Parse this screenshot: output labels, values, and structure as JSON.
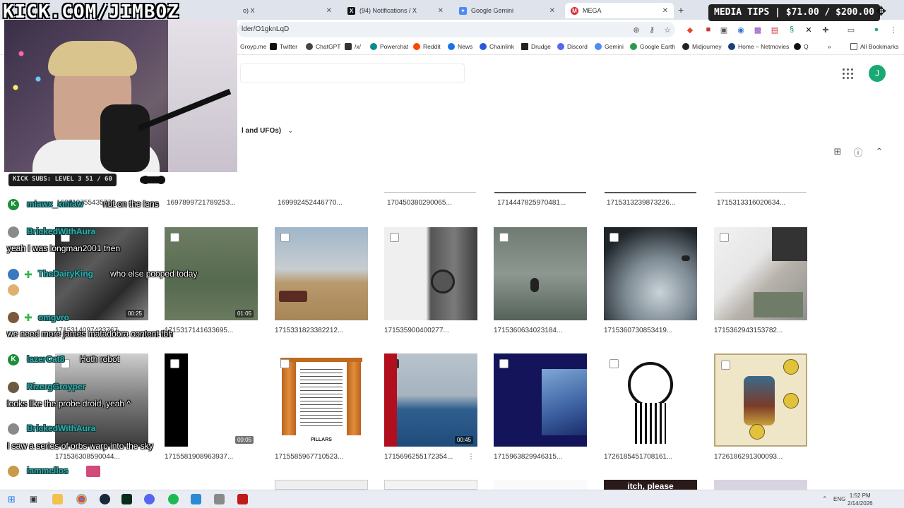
{
  "overlay": {
    "watermark": "KICK.COM/JIMBOZ",
    "media_tips": "MEDIA TIPS | $71.00 / $200.00",
    "kick_subs": "KICK SUBS: LEVEL 3 51 / 60"
  },
  "tabs": [
    {
      "label": "o) X",
      "favicon": "x-icon"
    },
    {
      "label": "(94) Notifications / X",
      "favicon": "x-icon"
    },
    {
      "label": "Google Gemini",
      "favicon": "gemini-icon"
    },
    {
      "label": "MEGA",
      "favicon": "mega-icon",
      "active": true
    }
  ],
  "address": {
    "url": "lder/O1gknLqD"
  },
  "bookmarks": [
    {
      "label": "Groyp.me",
      "color": "#8b6bd6"
    },
    {
      "label": "Twitter",
      "color": "#111111"
    },
    {
      "label": "ChatGPT",
      "color": "#444444"
    },
    {
      "label": "/x/",
      "color": "#333333"
    },
    {
      "label": "Powerchat",
      "color": "#0b8a8a"
    },
    {
      "label": "Reddit",
      "color": "#ff4500"
    },
    {
      "label": "News",
      "color": "#1a73e8"
    },
    {
      "label": "Chainlink",
      "color": "#2a5ada"
    },
    {
      "label": "Drudge",
      "color": "#222222"
    },
    {
      "label": "Discord",
      "color": "#5865f2"
    },
    {
      "label": "Gemini",
      "color": "#4b8bf5"
    },
    {
      "label": "Google Earth",
      "color": "#2b9b4a"
    },
    {
      "label": "Midjourney",
      "color": "#222222"
    },
    {
      "label": "Home – Netmovies",
      "color": "#1a3f7a"
    },
    {
      "label": "Q",
      "color": "#111111"
    },
    {
      "label": "All Bookmarks",
      "color": "#555555"
    }
  ],
  "mega": {
    "folder_title": "l and UFOs)",
    "avatar_initial": "J",
    "top_row_names": [
      "169819755435776...",
      "169789972178925З...",
      "169992452446770...",
      "170450380290065...",
      "171444782597048​1...",
      "171531323987322​6...",
      "171531331602063​4..."
    ],
    "rows": [
      {
        "items": [
          {
            "name": "171531409742376​7...",
            "duration": "00:25",
            "checked": false
          },
          {
            "name": "171531714163369​5...",
            "duration": "01:05",
            "checked": false
          },
          {
            "name": "171533182338221​2...",
            "duration": "",
            "checked": false
          },
          {
            "name": "171535900400277...",
            "duration": "",
            "checked": false
          },
          {
            "name": "171536063402318​4...",
            "duration": "",
            "checked": false
          },
          {
            "name": "171536073085341​9...",
            "duration": "",
            "checked": false
          },
          {
            "name": "171536294315378​2...",
            "duration": "",
            "checked": false
          }
        ]
      },
      {
        "items": [
          {
            "name": "171536308590044...",
            "duration": "",
            "checked": false
          },
          {
            "name": "171558190896393​7...",
            "duration": "00:05",
            "checked": false
          },
          {
            "name": "171558596771052​3...",
            "duration": "",
            "checked": false
          },
          {
            "name": "171569625517235​4...",
            "duration": "00:45",
            "checked": true
          },
          {
            "name": "171596382994631​5...",
            "duration": "",
            "checked": false
          },
          {
            "name": "172618545170816​1...",
            "duration": "",
            "checked": false
          },
          {
            "name": "172618629130009​3...",
            "duration": "",
            "checked": false
          }
        ]
      }
    ],
    "pillars_label": "PILLARS",
    "bottom_peek_text": "itch, please"
  },
  "chat": [
    {
      "user": "miawx_xmiaw",
      "msg": "nut on the lens",
      "badge": "kick"
    },
    {
      "user": "BrickedWithAura",
      "msg": "yeah I was longman2001 then",
      "badge": ""
    },
    {
      "user": "TheDairyKing",
      "msg": "who else pooped today",
      "badge": "plus"
    },
    {
      "user": "omgvro",
      "msg": "we need more james matadobra content tbh",
      "badge": "plus"
    },
    {
      "user": "lazerCat8",
      "msg": "Hoth robot",
      "badge": "kick"
    },
    {
      "user": "RizergGroyper",
      "msg": "looks like the probe droid, yeah ^",
      "badge": ""
    },
    {
      "user": "BrickedWithAura",
      "msg": "I saw a series of orbs warp into the sky",
      "badge": ""
    },
    {
      "user": "iammellos",
      "msg": "",
      "badge": ""
    }
  ],
  "taskbar": {
    "lang": "ENG",
    "time": "1:52 PM",
    "date": "2/14/2026"
  }
}
